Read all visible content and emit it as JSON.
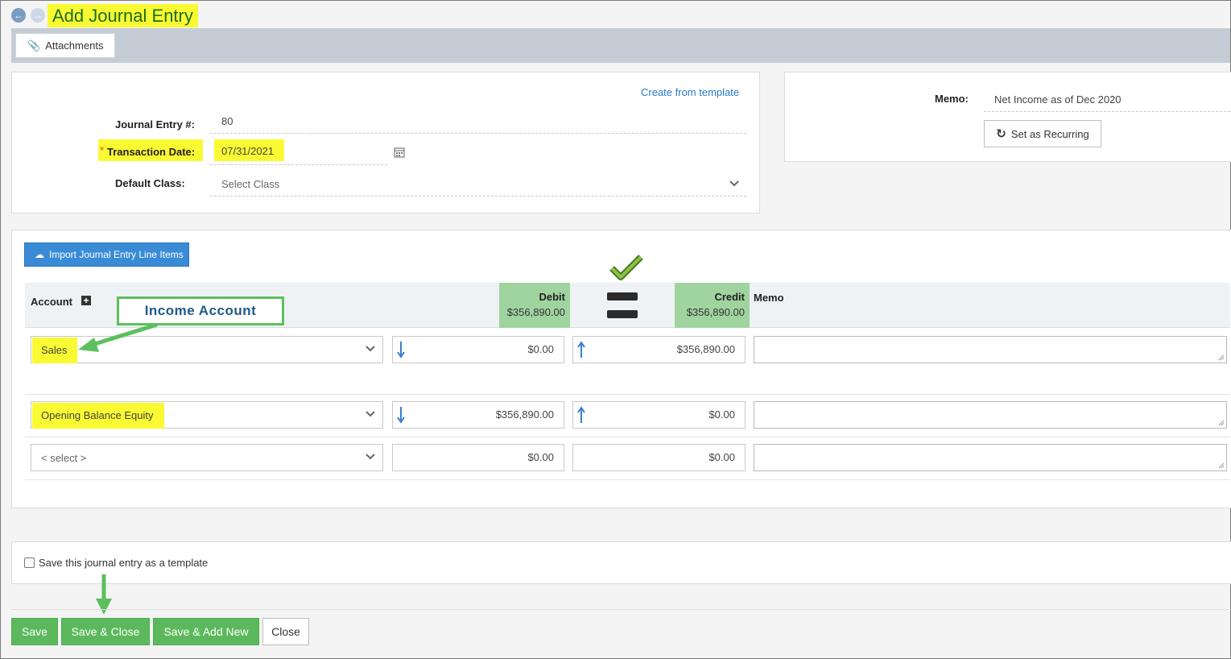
{
  "title": "Add Journal Entry",
  "toolbar": {
    "attachments_label": "Attachments"
  },
  "form": {
    "create_from_template": "Create from template",
    "journal_entry_label": "Journal Entry #:",
    "journal_entry_value": "80",
    "required_mark": "*",
    "transaction_date_label": "Transaction Date:",
    "transaction_date_value": "07/31/2021",
    "default_class_label": "Default Class:",
    "default_class_placeholder": "Select Class"
  },
  "memo_panel": {
    "memo_label": "Memo:",
    "memo_value": "Net Income as of Dec 2020",
    "recurring_label": "Set as Recurring"
  },
  "lines": {
    "import_label": "Import Journal Entry Line Items",
    "headers": {
      "account": "Account",
      "debit": "Debit",
      "debit_total": "$356,890.00",
      "credit": "Credit",
      "credit_total": "$356,890.00",
      "memo": "Memo"
    },
    "rows": [
      {
        "account": "Sales",
        "debit": "$0.00",
        "credit": "$356,890.00"
      },
      {
        "account": "Opening Balance Equity",
        "debit": "$356,890.00",
        "credit": "$0.00"
      },
      {
        "account": "< select >",
        "debit": "$0.00",
        "credit": "$0.00"
      }
    ]
  },
  "annotation": {
    "callout": "Income Account"
  },
  "template_checkbox_label": "Save this journal entry as a template",
  "buttons": {
    "save": "Save",
    "save_close": "Save & Close",
    "save_add_new": "Save & Add New",
    "close": "Close"
  },
  "colors": {
    "highlight": "#fafa33",
    "primary_blue": "#3a8bd6",
    "success_green": "#5cb85c",
    "header_green": "#9fd49f",
    "annotation_green": "#5cbf5c"
  }
}
